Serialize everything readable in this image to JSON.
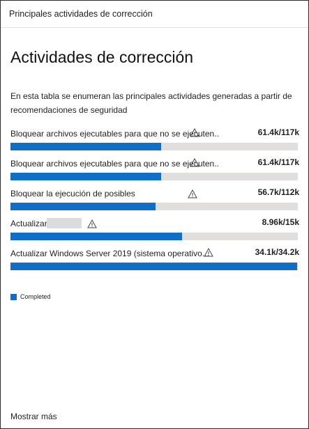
{
  "card": {
    "header": "Principales actividades de corrección",
    "title": "Actividades de corrección",
    "description": "En esta tabla se enumeran las principales actividades generadas a partir de recomendaciones de seguridad"
  },
  "activities": [
    {
      "label": "Bloquear archivos ejecutables para que no se ejecuten...",
      "value": "61.4k/117k",
      "progress": 0.525,
      "warning": true
    },
    {
      "label": "Bloquear archivos ejecutables para que no se ejecuten...",
      "value": "61.4k/117k",
      "progress": 0.525,
      "warning": true
    },
    {
      "label": "Bloquear la ejecución de posibles",
      "value": "56.7k/112k",
      "progress": 0.506,
      "warning": true
    },
    {
      "label": "Actualizar",
      "value": "8.96k/15k",
      "progress": 0.597,
      "warning": true,
      "redacted": true
    },
    {
      "label": "Actualizar Windows Server 2019 (sistema operativo...",
      "value": "34.1k/34.2k",
      "progress": 0.997,
      "warning": true
    }
  ],
  "legend": {
    "label": "Completed",
    "color": "#0f6fc6"
  },
  "footer": {
    "show_more": "Mostrar más"
  },
  "colors": {
    "accent": "#0f6fc6",
    "track": "#e1dfdd"
  }
}
